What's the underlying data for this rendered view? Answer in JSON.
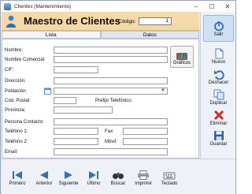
{
  "window": {
    "title": "Clientes  (Mantenimiento)"
  },
  "header": {
    "title": "Maestro de Clientes",
    "code_label": "Código:",
    "code_value": "1"
  },
  "tabs": [
    {
      "label": "Lista"
    },
    {
      "label": "Datos"
    }
  ],
  "form": {
    "nombre": "Nombre:",
    "nombre_comercial": "Nombre Comercial:",
    "cif": "CIF:",
    "direccion": "Dirección:",
    "poblacion": "Población:",
    "cod_postal": "Cód. Postal:",
    "prefijo": "Prefijo Telefónico:",
    "provincia": "Provincia:",
    "persona_contacto": "Persona Contacto:",
    "telefono1": "Teléfono 1:",
    "fax": "Fax:",
    "telefono2": "Teléfono 2:",
    "movil": "Móvil:",
    "email": "Email:",
    "graficos": "Gráficos"
  },
  "sidebar": {
    "salir": "Salir",
    "nuevo": "Nuevo",
    "deshacer": "Deshacer",
    "duplicar": "Duplicar",
    "eliminar": "Eliminar",
    "guardar": "Guardar"
  },
  "toolbar": {
    "primero": "Primero",
    "anterior": "Anterior",
    "siguiente": "Siguiente",
    "ultimo": "Último",
    "buscar": "Buscar",
    "imprimir": "Imprimir",
    "teclado": "Teclado"
  },
  "colors": {
    "header_bg": "#f5d9a8",
    "accent": "#2f6fc0",
    "delete": "#d82a1c"
  }
}
